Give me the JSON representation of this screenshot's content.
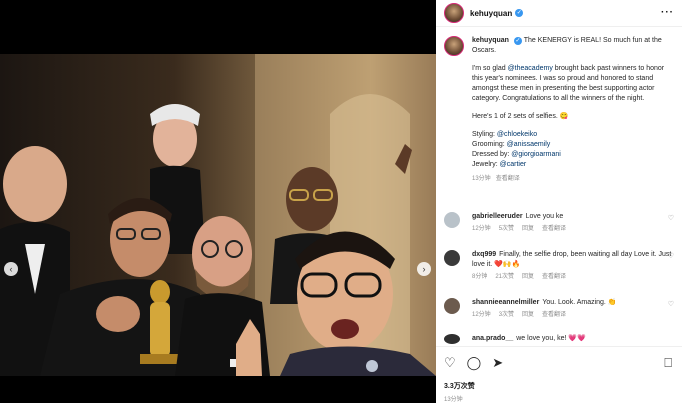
{
  "post": {
    "username": "kehuyquan",
    "verified_mark": "✓",
    "more_label": "···",
    "caption": {
      "username": "kehuyquan",
      "line1": "The KENERGY is REAL! So much fun at the Oscars.",
      "p2_a": "I'm so glad ",
      "p2_link": "@theacademy",
      "p2_b": " brought back past winners to honor this year's nominees. I was so proud and honored to stand amongst these men in presenting the best supporting actor category. Congratulations to all the winners of the night.",
      "p3": "Here's 1 of 2 sets of selfies. 😋",
      "styling_label": "Styling: ",
      "styling": "@chloekeiko",
      "grooming_label": "Grooming: ",
      "grooming": "@anissaemily",
      "dressed_label": "Dressed by: ",
      "dressed": "@giorgioarmani",
      "jewelry_label": "Jewelry: ",
      "jewelry": "@cartier",
      "time": "13分钟",
      "translate": "查看翻译"
    }
  },
  "comments": [
    {
      "user": "gabrielleeruder",
      "text": "Love you ke",
      "time": "12分钟",
      "likes": "5次赞",
      "reply": "回复",
      "translate": "查看翻译"
    },
    {
      "user": "dxq999",
      "text": "Finally, the selfie drop, been waiting all day Love it. Just love it. ❤️🙌🔥",
      "time": "8分钟",
      "likes": "21次赞",
      "reply": "回复",
      "translate": "查看翻译"
    },
    {
      "user": "shannieeannelmiller",
      "text": "You. Look. Amazing. 👏",
      "time": "12分钟",
      "likes": "3次赞",
      "reply": "回复",
      "translate": "查看翻译"
    },
    {
      "user": "ana.prado__",
      "text": "we love you, ke! 💗💗"
    }
  ],
  "footer": {
    "like_icon": "♡",
    "comment_icon": "◯",
    "share_icon": "➤",
    "bookmark_icon": "⎕",
    "likes": "3.3万次赞",
    "date": "13分钟"
  },
  "carousel": {
    "total": 7,
    "active_index": 0
  },
  "colors": {
    "accent": "#3897f0",
    "ring": "#d62976"
  }
}
